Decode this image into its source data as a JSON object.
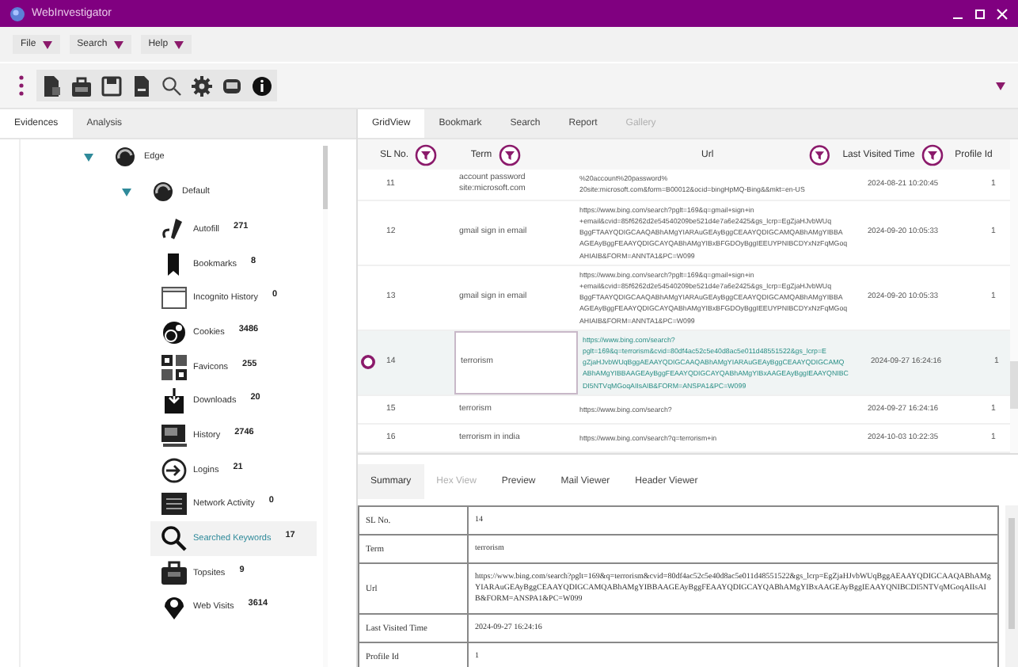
{
  "window": {
    "title": "WebInvestigator"
  },
  "menu": [
    {
      "label": "File"
    },
    {
      "label": "Search"
    },
    {
      "label": "Help"
    }
  ],
  "left_tabs": [
    {
      "label": "Evidences",
      "selected": true
    },
    {
      "label": "Analysis",
      "selected": false
    }
  ],
  "tree": [
    {
      "label": "Edge",
      "expanded": true,
      "children": [
        {
          "label": "Default",
          "expanded": true,
          "children": [
            {
              "label": "Autofill",
              "count": "271",
              "selected": false
            },
            {
              "label": "Bookmarks",
              "count": "8",
              "selected": false
            },
            {
              "label": "Incognito History",
              "count": "0",
              "selected": false
            },
            {
              "label": "Cookies",
              "count": "3486",
              "selected": false
            },
            {
              "label": "Favicons",
              "count": "255",
              "selected": false
            },
            {
              "label": "Downloads",
              "count": "20",
              "selected": false
            },
            {
              "label": "History",
              "count": "2746",
              "selected": false
            },
            {
              "label": "Logins",
              "count": "21",
              "selected": false
            },
            {
              "label": "Network Activity",
              "count": "0",
              "selected": false
            },
            {
              "label": "Searched Keywords",
              "count": "17",
              "selected": true
            },
            {
              "label": "Topsites",
              "count": "9",
              "selected": false
            },
            {
              "label": "Web Visits",
              "count": "3614",
              "selected": false
            }
          ]
        }
      ]
    }
  ],
  "grid_tabs": [
    {
      "label": "GridView",
      "selected": true,
      "disabled": false
    },
    {
      "label": "Bookmark",
      "selected": false,
      "disabled": false
    },
    {
      "label": "Search",
      "selected": false,
      "disabled": false
    },
    {
      "label": "Report",
      "selected": false,
      "disabled": false
    },
    {
      "label": "Gallery",
      "selected": false,
      "disabled": true
    }
  ],
  "grid": {
    "columns": [
      {
        "label": "SL No.",
        "filter": true
      },
      {
        "label": "Term",
        "filter": true
      },
      {
        "label": "Url",
        "filter": true
      },
      {
        "label": "Last Visited Time",
        "filter": true
      },
      {
        "label": "Profile Id",
        "filter": false
      }
    ],
    "rows": [
      {
        "sl_no": "11",
        "term": "account password site:microsoft.com",
        "url": [
          "%20account%20password%",
          "20site:microsoft.com&form=B00012&ocid=bingHpMQ-Bing&&mkt=en-US"
        ],
        "last_visited_time": "2024-08-21 10:20:45",
        "profile_id": "1",
        "selected": false
      },
      {
        "sl_no": "12",
        "term": "gmail sign in email",
        "url": [
          "https://www.bing.com/search?pglt=169&q=gmail+sign+in",
          "+email&cvid=85f6262d2e54540209be521d4e7a6e2425&gs_lcrp=EgZjaHJvbWUq",
          "BggFTAAYQDIGCAAQABhAMgYIARAuGEAyBggCEAAYQDIGCAMQABhAMgYIBBA",
          "AGEAyBggFEAAYQDIGCAYQABhAMgYIBxBFGDOyBggIEEUYPNIBCDYxNzFqMGoq",
          "AHIAIB&FORM=ANNTA1&PC=W099"
        ],
        "last_visited_time": "2024-09-20 10:05:33",
        "profile_id": "1",
        "selected": false
      },
      {
        "sl_no": "13",
        "term": "gmail sign in email",
        "url": [
          "https://www.bing.com/search?pglt=169&q=gmail+sign+in",
          "+email&cvid=85f6262d2e54540209be521d4e7a6e2425&gs_lcrp=EgZjaHJvbWUq",
          "BggFTAAYQDIGCAAQABhAMgYIARAuGEAyBggCEAAYQDIGCAMQABhAMgYIBBA",
          "AGEAyBggFEAAYQDIGCAYQABhAMgYIBxBFGDOyBggIEEUYPNIBCDYxNzFqMGoq",
          "AHIAIB&FORM=ANNTA1&PC=W099"
        ],
        "last_visited_time": "2024-09-20 10:05:33",
        "profile_id": "1",
        "selected": false
      },
      {
        "sl_no": "14",
        "term": "terrorism",
        "url": [
          "https://www.bing.com/search?",
          "pglt=169&q=terrorism&cvid=80df4ac52c5e40d8ac5e011d48551522&gs_lcrp=E",
          "gZjaHJvbWUqBggAEAAYQDIGCAAQABhAMgYIARAuGEAyBggCEAAYQDIGCAMQ",
          "ABhAMgYIBBAAGEAyBggFEAAYQDIGCAYQABhAMgYIBxAAGEAyBggIEAAYQNIBC",
          "DI5NTVqMGoqAIIsAIB&FORM=ANSPA1&PC=W099"
        ],
        "last_visited_time": "2024-09-27 16:24:16",
        "profile_id": "1",
        "selected": true
      },
      {
        "sl_no": "15",
        "term": "terrorism",
        "url": [
          "https://www.bing.com/search?"
        ],
        "last_visited_time": "2024-09-27 16:24:16",
        "profile_id": "1",
        "selected": false
      },
      {
        "sl_no": "16",
        "term": "terrorism in india",
        "url": [
          "https://www.bing.com/search?q=terrorism+in"
        ],
        "last_visited_time": "2024-10-03 10:22:35",
        "profile_id": "1",
        "selected": false
      }
    ]
  },
  "detail_tabs": [
    {
      "label": "Summary",
      "selected": true,
      "disabled": false
    },
    {
      "label": "Hex View",
      "selected": false,
      "disabled": true
    },
    {
      "label": "Preview",
      "selected": false,
      "disabled": false
    },
    {
      "label": "Mail Viewer",
      "selected": false,
      "disabled": false
    },
    {
      "label": "Header Viewer",
      "selected": false,
      "disabled": false
    }
  ],
  "summary": [
    {
      "field": "SL No.",
      "value": "14"
    },
    {
      "field": "Term",
      "value": "terrorism"
    },
    {
      "field": "Url",
      "value": "https://www.bing.com/search?pglt=169&q=terrorism&cvid=80df4ac52c5e40d8ac5e011d48551522&gs_lcrp=EgZjaHJvbWUqBggAEAAYQDIGCAAQABhAMgYIARAuGEAyBggCEAAYQDIGCAMQABhAMgYIBBAAGEAyBggFEAAYQDIGCAYQABhAMgYIBxAAGEAyBggIEAAYQNIBCDI5NTVqMGoqAIIsAIB&FORM=ANSPA1&PC=W099"
    },
    {
      "field": "Last Visited Time",
      "value": "2024-09-27 16:24:16"
    },
    {
      "field": "Profile Id",
      "value": "1"
    }
  ]
}
